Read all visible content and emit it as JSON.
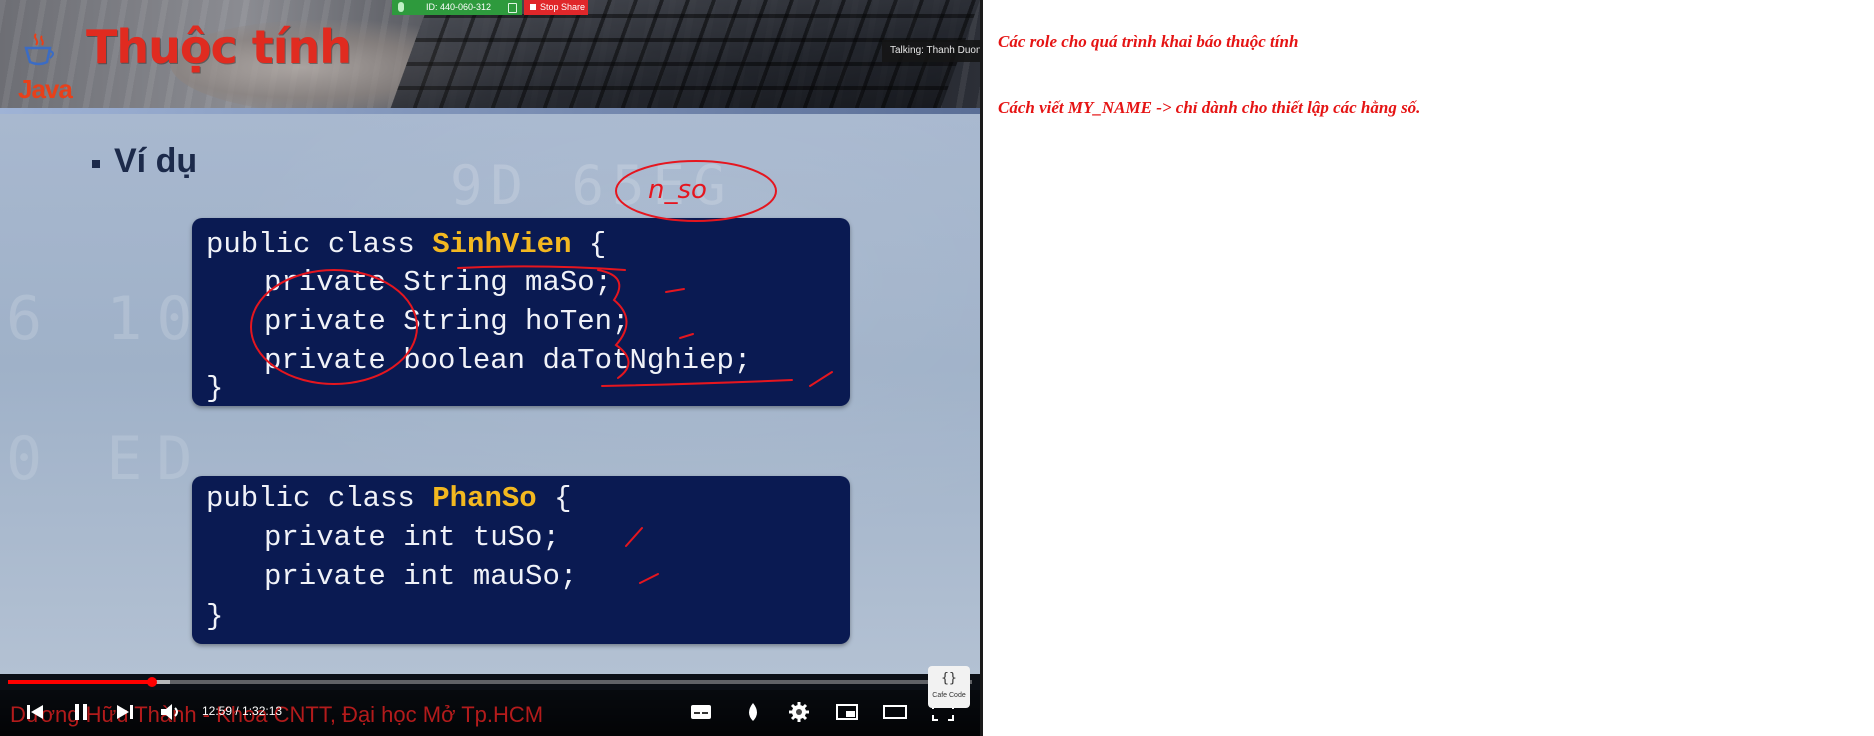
{
  "video": {
    "slide": {
      "logo_text": "Java",
      "title": "Thuộc tính",
      "bullet": "Ví dụ",
      "watermarks": [
        "9D 65EG",
        "6 101",
        "0 ED"
      ],
      "code_block_1": {
        "lines": [
          {
            "pre": "public class ",
            "name": "SinhVien",
            "post": " {"
          },
          {
            "text": "private String maSo;"
          },
          {
            "text": "private String hoTen;"
          },
          {
            "text": "private boolean daTotNghiep;"
          },
          {
            "text": "}"
          }
        ]
      },
      "code_block_2": {
        "lines": [
          {
            "pre": "public class ",
            "name": "PhanSo",
            "post": " {"
          },
          {
            "text": "private int tuSo;"
          },
          {
            "text": "private int mauSo;"
          },
          {
            "text": "}"
          }
        ]
      },
      "handwritten_note": "n_so",
      "annotation_color": "#e5161f"
    },
    "meeting": {
      "id_label": "ID: 440-060-312",
      "stop_share_label": "Stop Share",
      "talking_label": "Talking: Thanh Duong"
    },
    "player": {
      "progress_fraction": 0.1489,
      "buffer_fraction": 0.168,
      "time_current": "12:59",
      "time_separator": " / ",
      "time_total": "1:32:13",
      "channel_text": "Dương Hữu Thành - Khoa CNTT, Đại học Mở Tp.HCM",
      "buttons": [
        "previous-icon",
        "pause-icon",
        "next-icon",
        "volume-icon",
        "subtitles-icon",
        "contrast-icon",
        "settings-icon",
        "miniplayer-icon",
        "theater-icon",
        "fullscreen-icon"
      ],
      "logo_mark": "{}",
      "logo_text": "Cafe Code",
      "accent": "#ff0000"
    }
  },
  "notes": {
    "line_1": "Các role cho quá trình khai báo thuộc tính",
    "line_2": "Cách viết MY_NAME -> chỉ dành cho thiết lập các hằng số.",
    "color": "#e51414"
  }
}
